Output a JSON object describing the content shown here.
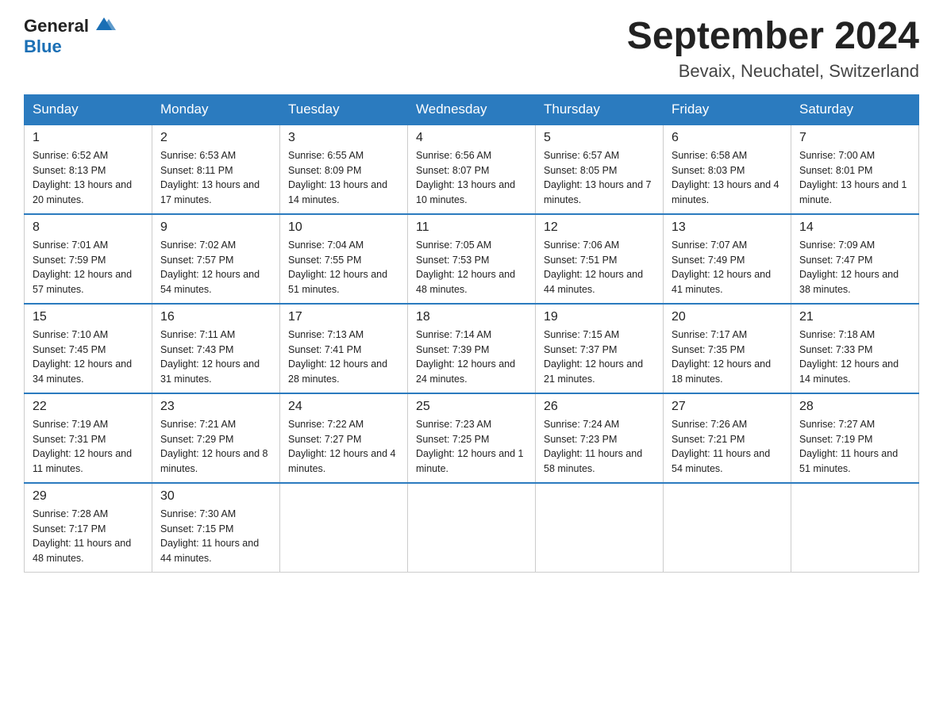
{
  "header": {
    "logo_general": "General",
    "logo_blue": "Blue",
    "title": "September 2024",
    "subtitle": "Bevaix, Neuchatel, Switzerland"
  },
  "weekdays": [
    "Sunday",
    "Monday",
    "Tuesday",
    "Wednesday",
    "Thursday",
    "Friday",
    "Saturday"
  ],
  "weeks": [
    [
      {
        "day": "1",
        "sunrise": "6:52 AM",
        "sunset": "8:13 PM",
        "daylight": "13 hours and 20 minutes."
      },
      {
        "day": "2",
        "sunrise": "6:53 AM",
        "sunset": "8:11 PM",
        "daylight": "13 hours and 17 minutes."
      },
      {
        "day": "3",
        "sunrise": "6:55 AM",
        "sunset": "8:09 PM",
        "daylight": "13 hours and 14 minutes."
      },
      {
        "day": "4",
        "sunrise": "6:56 AM",
        "sunset": "8:07 PM",
        "daylight": "13 hours and 10 minutes."
      },
      {
        "day": "5",
        "sunrise": "6:57 AM",
        "sunset": "8:05 PM",
        "daylight": "13 hours and 7 minutes."
      },
      {
        "day": "6",
        "sunrise": "6:58 AM",
        "sunset": "8:03 PM",
        "daylight": "13 hours and 4 minutes."
      },
      {
        "day": "7",
        "sunrise": "7:00 AM",
        "sunset": "8:01 PM",
        "daylight": "13 hours and 1 minute."
      }
    ],
    [
      {
        "day": "8",
        "sunrise": "7:01 AM",
        "sunset": "7:59 PM",
        "daylight": "12 hours and 57 minutes."
      },
      {
        "day": "9",
        "sunrise": "7:02 AM",
        "sunset": "7:57 PM",
        "daylight": "12 hours and 54 minutes."
      },
      {
        "day": "10",
        "sunrise": "7:04 AM",
        "sunset": "7:55 PM",
        "daylight": "12 hours and 51 minutes."
      },
      {
        "day": "11",
        "sunrise": "7:05 AM",
        "sunset": "7:53 PM",
        "daylight": "12 hours and 48 minutes."
      },
      {
        "day": "12",
        "sunrise": "7:06 AM",
        "sunset": "7:51 PM",
        "daylight": "12 hours and 44 minutes."
      },
      {
        "day": "13",
        "sunrise": "7:07 AM",
        "sunset": "7:49 PM",
        "daylight": "12 hours and 41 minutes."
      },
      {
        "day": "14",
        "sunrise": "7:09 AM",
        "sunset": "7:47 PM",
        "daylight": "12 hours and 38 minutes."
      }
    ],
    [
      {
        "day": "15",
        "sunrise": "7:10 AM",
        "sunset": "7:45 PM",
        "daylight": "12 hours and 34 minutes."
      },
      {
        "day": "16",
        "sunrise": "7:11 AM",
        "sunset": "7:43 PM",
        "daylight": "12 hours and 31 minutes."
      },
      {
        "day": "17",
        "sunrise": "7:13 AM",
        "sunset": "7:41 PM",
        "daylight": "12 hours and 28 minutes."
      },
      {
        "day": "18",
        "sunrise": "7:14 AM",
        "sunset": "7:39 PM",
        "daylight": "12 hours and 24 minutes."
      },
      {
        "day": "19",
        "sunrise": "7:15 AM",
        "sunset": "7:37 PM",
        "daylight": "12 hours and 21 minutes."
      },
      {
        "day": "20",
        "sunrise": "7:17 AM",
        "sunset": "7:35 PM",
        "daylight": "12 hours and 18 minutes."
      },
      {
        "day": "21",
        "sunrise": "7:18 AM",
        "sunset": "7:33 PM",
        "daylight": "12 hours and 14 minutes."
      }
    ],
    [
      {
        "day": "22",
        "sunrise": "7:19 AM",
        "sunset": "7:31 PM",
        "daylight": "12 hours and 11 minutes."
      },
      {
        "day": "23",
        "sunrise": "7:21 AM",
        "sunset": "7:29 PM",
        "daylight": "12 hours and 8 minutes."
      },
      {
        "day": "24",
        "sunrise": "7:22 AM",
        "sunset": "7:27 PM",
        "daylight": "12 hours and 4 minutes."
      },
      {
        "day": "25",
        "sunrise": "7:23 AM",
        "sunset": "7:25 PM",
        "daylight": "12 hours and 1 minute."
      },
      {
        "day": "26",
        "sunrise": "7:24 AM",
        "sunset": "7:23 PM",
        "daylight": "11 hours and 58 minutes."
      },
      {
        "day": "27",
        "sunrise": "7:26 AM",
        "sunset": "7:21 PM",
        "daylight": "11 hours and 54 minutes."
      },
      {
        "day": "28",
        "sunrise": "7:27 AM",
        "sunset": "7:19 PM",
        "daylight": "11 hours and 51 minutes."
      }
    ],
    [
      {
        "day": "29",
        "sunrise": "7:28 AM",
        "sunset": "7:17 PM",
        "daylight": "11 hours and 48 minutes."
      },
      {
        "day": "30",
        "sunrise": "7:30 AM",
        "sunset": "7:15 PM",
        "daylight": "11 hours and 44 minutes."
      },
      null,
      null,
      null,
      null,
      null
    ]
  ],
  "sunrise_label": "Sunrise:",
  "sunset_label": "Sunset:",
  "daylight_label": "Daylight:"
}
